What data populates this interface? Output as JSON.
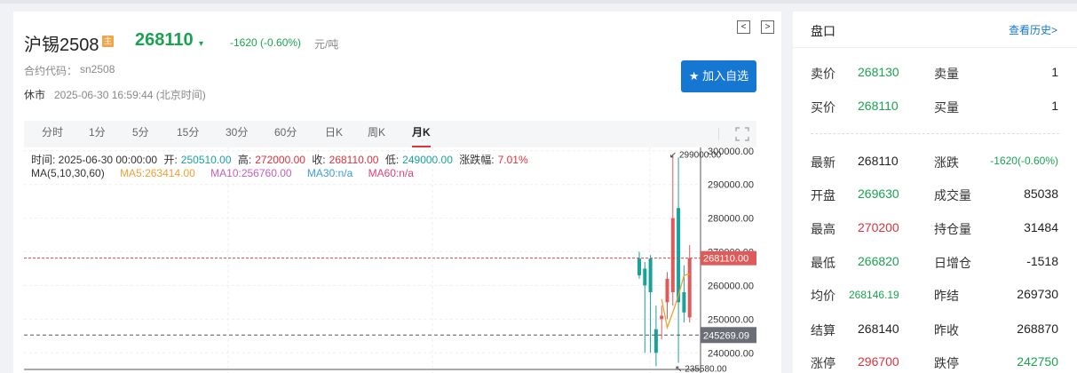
{
  "header": {
    "name": "沪锡2508",
    "badge": "主",
    "price": "268110",
    "change": "-1620 (-0.60%)",
    "unit": "元/吨",
    "code_label": "合约代码：",
    "code_value": "sn2508",
    "status": "休市",
    "timestamp": "2025-06-30 16:59:44 (北京时间)",
    "nav_prev": "<",
    "nav_next": ">",
    "favorite_label": "加入自选"
  },
  "tabs": [
    "分时",
    "1分",
    "5分",
    "15分",
    "30分",
    "60分",
    "日K",
    "周K",
    "月K"
  ],
  "active_tab": "月K",
  "info": {
    "time_label": "时间: 2025-06-30 00:00:00",
    "open_label": "开:",
    "open_value": "250510.00",
    "high_label": "高:",
    "high_value": "272000.00",
    "close_label": "收:",
    "close_value": "268110.00",
    "low_label": "低:",
    "low_value": "249000.00",
    "pct_label": "涨跌幅:",
    "pct_value": "7.01%"
  },
  "ma": {
    "label": "MA(5,10,30,60)",
    "ma5": "MA5:263414.00",
    "ma10": "MA10:256760.00",
    "ma30": "MA30:n/a",
    "ma60": "MA60:n/a"
  },
  "colors": {
    "up": "#e05a5a",
    "down": "#1aa29a",
    "ma5": "#f0a030",
    "ma10": "#c060c0",
    "ma30": "#3a9be0",
    "ma60": "#e0407a",
    "accent": "#1677d2"
  },
  "chart_data": {
    "type": "candlestick",
    "y_ticks": [
      "300000.00",
      "290000.00",
      "280000.00",
      "270000.00",
      "260000.00",
      "250000.00",
      "240000.00"
    ],
    "ylim": [
      234000,
      301000
    ],
    "max_label": "299000.00",
    "min_label": "235580.00",
    "current_price_label": "268110.00",
    "crosshair_label": "245269.09",
    "current_price": 268110,
    "crosshair_price": 245269.09,
    "candles": [
      {
        "o": 268000,
        "h": 270000,
        "l": 262000,
        "c": 263000
      },
      {
        "o": 265000,
        "h": 267000,
        "l": 240000,
        "c": 260000
      },
      {
        "o": 268000,
        "h": 269000,
        "l": 240000,
        "c": 258000
      },
      {
        "o": 247000,
        "h": 254000,
        "l": 236000,
        "c": 240000
      },
      {
        "o": 250000,
        "h": 254000,
        "l": 244000,
        "c": 251000
      },
      {
        "o": 255000,
        "h": 264000,
        "l": 250000,
        "c": 262000
      },
      {
        "o": 258000,
        "h": 299000,
        "l": 254000,
        "c": 280000
      },
      {
        "o": 283000,
        "h": 298000,
        "l": 237000,
        "c": 255000
      },
      {
        "o": 258000,
        "h": 266000,
        "l": 249000,
        "c": 252000
      },
      {
        "o": 250510,
        "h": 272000,
        "l": 249000,
        "c": 268110
      }
    ],
    "ma5": [
      null,
      null,
      null,
      null,
      256000,
      247500,
      252000,
      257000,
      263000,
      263414
    ],
    "ma10": [
      null,
      null,
      null,
      null,
      null,
      null,
      null,
      null,
      null,
      256760
    ]
  },
  "panel": {
    "title": "盘口",
    "history_link": "查看历史>",
    "ask_label": "卖价",
    "ask_price": "268130",
    "ask_vol_label": "卖量",
    "ask_vol": "1",
    "bid_label": "买价",
    "bid_price": "268110",
    "bid_vol_label": "买量",
    "bid_vol": "1",
    "rows": [
      {
        "l1": "最新",
        "v1": "268110",
        "c1": "dark",
        "l2": "涨跌",
        "v2": "-1620(-0.60%)",
        "c2": "green"
      },
      {
        "l1": "开盘",
        "v1": "269630",
        "c1": "green",
        "l2": "成交量",
        "v2": "85038",
        "c2": "dark"
      },
      {
        "l1": "最高",
        "v1": "270200",
        "c1": "red",
        "l2": "持仓量",
        "v2": "31484",
        "c2": "dark"
      },
      {
        "l1": "最低",
        "v1": "266820",
        "c1": "green",
        "l2": "日增仓",
        "v2": "-1518",
        "c2": "dark"
      },
      {
        "l1": "均价",
        "v1": "268146.19",
        "c1": "green",
        "l2": "昨结",
        "v2": "269730",
        "c2": "dark"
      },
      {
        "l1": "结算",
        "v1": "268140",
        "c1": "dark",
        "l2": "昨收",
        "v2": "268870",
        "c2": "dark"
      },
      {
        "l1": "涨停",
        "v1": "296700",
        "c1": "red",
        "l2": "跌停",
        "v2": "242750",
        "c2": "green"
      }
    ]
  }
}
